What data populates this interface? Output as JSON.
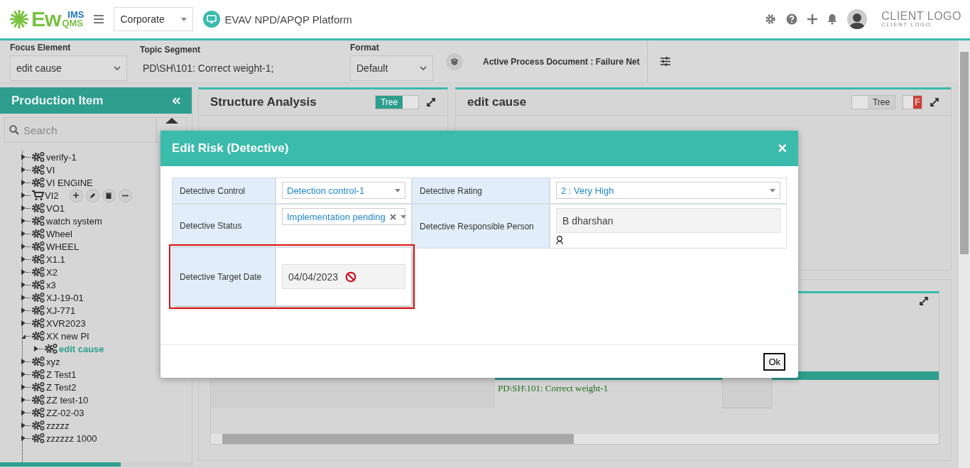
{
  "header": {
    "logo": {
      "main": "Ew",
      "top": "IMS",
      "bottom": "QMS"
    },
    "org_select": "Corporate",
    "platform": "EVAV NPD/APQP Platform",
    "client_logo": {
      "title": "CLIENT LOGO",
      "subtitle": "CLIENT LOGO"
    }
  },
  "filter_bar": {
    "focus_element": {
      "label": "Focus Element",
      "value": "edit cause"
    },
    "topic_segment": {
      "label": "Topic Segment",
      "value": "PD\\SH\\101: Correct weight-1;"
    },
    "format": {
      "label": "Format",
      "value": "Default"
    },
    "active_document": "Active Process Document : Failure Net"
  },
  "production_panel": {
    "title": "Production Item",
    "search_placeholder": "Search",
    "tree": [
      {
        "label": "verify-1",
        "kind": "gears",
        "expanded": false,
        "selected": false,
        "show_actions": false
      },
      {
        "label": "VI",
        "kind": "gears",
        "expanded": false,
        "selected": false,
        "show_actions": false
      },
      {
        "label": "VI ENGINE",
        "kind": "gears",
        "expanded": false,
        "selected": false,
        "show_actions": false
      },
      {
        "label": "VI2",
        "kind": "cart",
        "expanded": false,
        "selected": false,
        "show_actions": true
      },
      {
        "label": "VO1",
        "kind": "gears",
        "expanded": false,
        "selected": false,
        "show_actions": false
      },
      {
        "label": "watch system",
        "kind": "gears",
        "expanded": false,
        "selected": false,
        "show_actions": false
      },
      {
        "label": "Wheel",
        "kind": "gears",
        "expanded": false,
        "selected": false,
        "show_actions": false
      },
      {
        "label": "WHEEL",
        "kind": "gears",
        "expanded": false,
        "selected": false,
        "show_actions": false
      },
      {
        "label": "X1.1",
        "kind": "gears",
        "expanded": false,
        "selected": false,
        "show_actions": false
      },
      {
        "label": "X2",
        "kind": "gears",
        "expanded": false,
        "selected": false,
        "show_actions": false
      },
      {
        "label": "x3",
        "kind": "gears",
        "expanded": false,
        "selected": false,
        "show_actions": false
      },
      {
        "label": "XJ-19-01",
        "kind": "gears",
        "expanded": false,
        "selected": false,
        "show_actions": false
      },
      {
        "label": "XJ-771",
        "kind": "gears",
        "expanded": false,
        "selected": false,
        "show_actions": false
      },
      {
        "label": "XVR2023",
        "kind": "gears",
        "expanded": false,
        "selected": false,
        "show_actions": false
      },
      {
        "label": "XX new PI",
        "kind": "gears",
        "expanded": true,
        "selected": false,
        "show_actions": false,
        "children": [
          {
            "label": "edit cause",
            "kind": "gears",
            "expanded": false,
            "selected": true,
            "show_actions": false
          }
        ]
      },
      {
        "label": "xyz",
        "kind": "gears",
        "expanded": false,
        "selected": false,
        "show_actions": false
      },
      {
        "label": "Z Test1",
        "kind": "gears",
        "expanded": false,
        "selected": false,
        "show_actions": false
      },
      {
        "label": "Z Test2",
        "kind": "gears",
        "expanded": false,
        "selected": false,
        "show_actions": false
      },
      {
        "label": "ZZ test-10",
        "kind": "gears",
        "expanded": false,
        "selected": false,
        "show_actions": false
      },
      {
        "label": "ZZ-02-03",
        "kind": "gears",
        "expanded": false,
        "selected": false,
        "show_actions": false
      },
      {
        "label": "zzzzz",
        "kind": "gears",
        "expanded": false,
        "selected": false,
        "show_actions": false
      },
      {
        "label": "zzzzzz 1000",
        "kind": "gears",
        "expanded": false,
        "selected": false,
        "show_actions": false
      }
    ]
  },
  "structure_panel": {
    "title": "Structure Analysis",
    "toggle": {
      "label": "Tree",
      "on": true
    }
  },
  "edit_cause_panel": {
    "title": "edit cause",
    "tree_toggle": {
      "label": "Tree",
      "on": false
    },
    "f_toggle": {
      "label": "F",
      "on": true
    }
  },
  "grid_panel": {
    "cell": "PD\\SH\\101: Correct weight-1"
  },
  "dialog": {
    "title": "Edit Risk (Detective)",
    "close": "×",
    "fields": [
      {
        "label": "Detective Control",
        "kind": "select",
        "value": "Detection control-1",
        "clearable": false,
        "highlighted": false
      },
      {
        "label": "Detective Rating",
        "kind": "select",
        "value": "2 : Very High",
        "clearable": false,
        "highlighted": false
      },
      {
        "label": "Detective Status",
        "kind": "select",
        "value": "Implementation pending",
        "clearable": true,
        "highlighted": false
      },
      {
        "label": "Detective Responsible Person",
        "kind": "person",
        "value": "B dharshan",
        "clearable": false,
        "highlighted": false
      },
      {
        "label": "Detective Target Date",
        "kind": "date",
        "value": "04/04/2023",
        "clearable": false,
        "highlighted": true
      }
    ],
    "ok": "Ok"
  }
}
